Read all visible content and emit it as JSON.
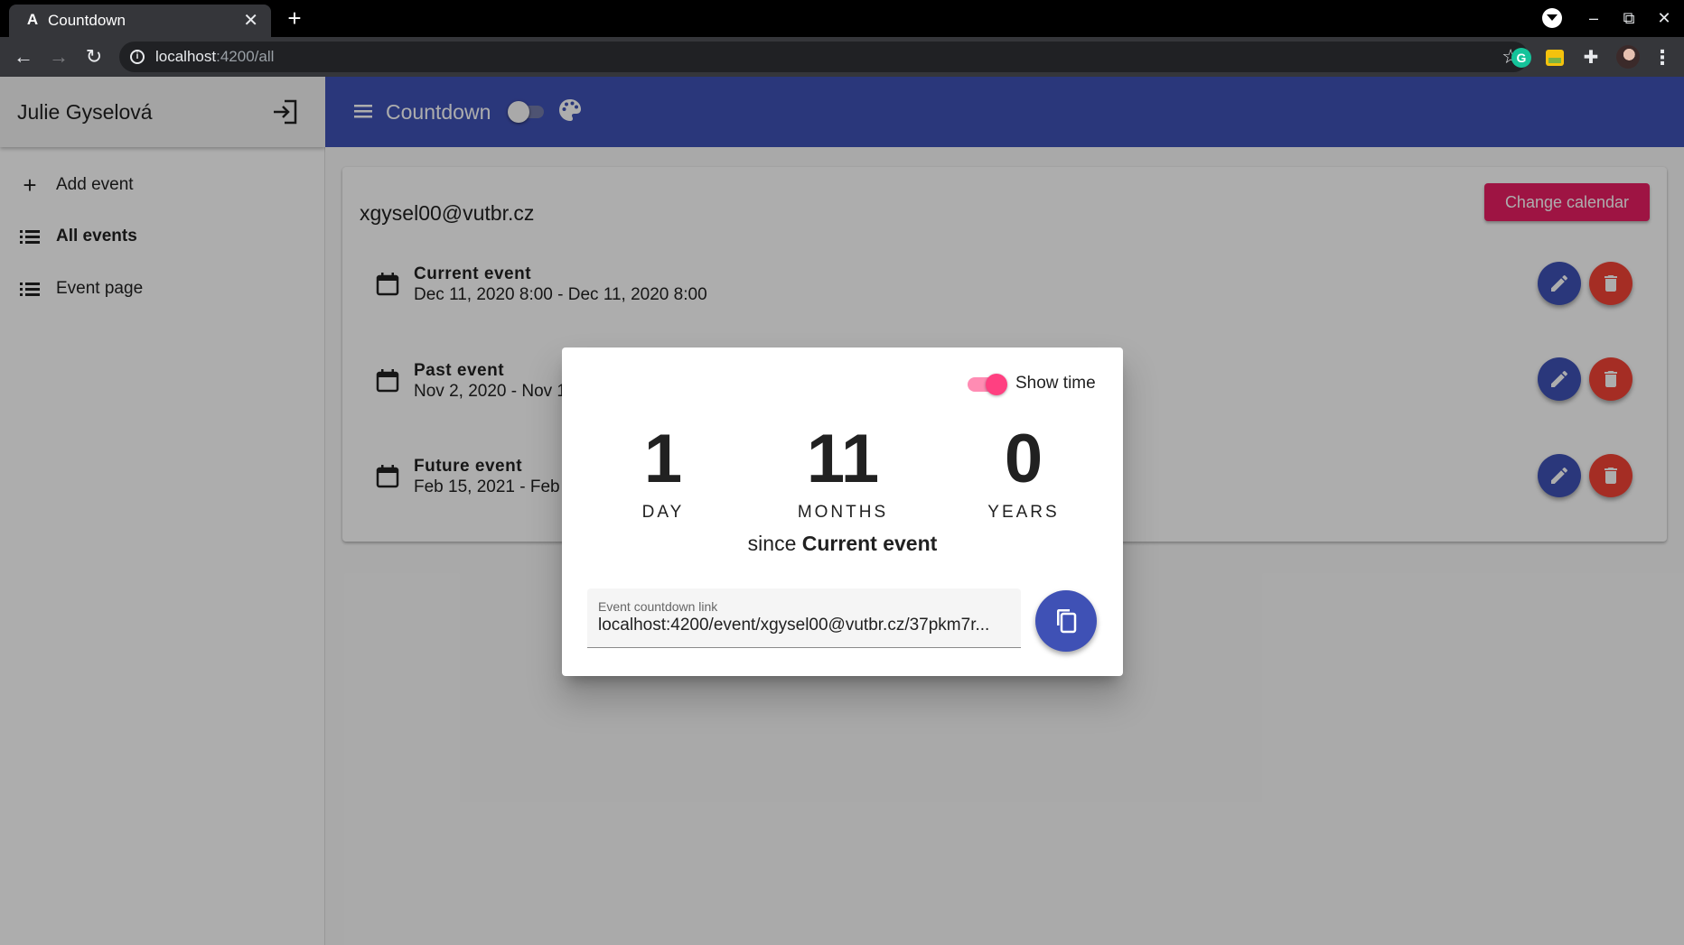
{
  "browser": {
    "tab_title": "Countdown",
    "tab_favicon": "A",
    "url_host": "localhost",
    "url_path": ":4200/all",
    "grammarly_letter": "G"
  },
  "sidebar": {
    "user_name": "Julie Gyselová",
    "items": [
      {
        "label": "Add event",
        "icon": "plus-icon",
        "active": false
      },
      {
        "label": "All events",
        "icon": "list-icon",
        "active": true
      },
      {
        "label": "Event page",
        "icon": "list-icon",
        "active": false
      }
    ]
  },
  "appbar": {
    "title": "Countdown",
    "theme_toggle_on": false
  },
  "calendar": {
    "email": "xgysel00@vutbr.cz",
    "change_label": "Change calendar",
    "events": [
      {
        "name": "Current event",
        "dates": "Dec 11, 2020 8:00 - Dec 11, 2020 8:00"
      },
      {
        "name": "Past event",
        "dates": "Nov 2, 2020 - Nov 1"
      },
      {
        "name": "Future event",
        "dates": "Feb 15, 2021 - Feb 2"
      }
    ]
  },
  "dialog": {
    "show_time_label": "Show time",
    "show_time_on": true,
    "units": [
      {
        "value": "1",
        "label": "DAY"
      },
      {
        "value": "11",
        "label": "MONTHS"
      },
      {
        "value": "0",
        "label": "YEARS"
      }
    ],
    "since_prefix": "since",
    "since_event": "Current event",
    "link_label": "Event countdown link",
    "link_value": "localhost:4200/event/xgysel00@vutbr.cz/37pkm7r..."
  },
  "colors": {
    "primary": "#3f51b5",
    "accent": "#e91e63",
    "warn": "#f44336",
    "toggle_accent": "#ff4081"
  }
}
